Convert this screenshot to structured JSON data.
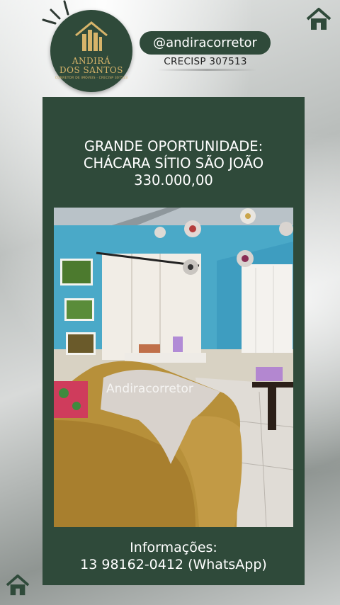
{
  "brand": {
    "name_line1": "ANDIRÁ",
    "name_line2": "DOS SANTOS",
    "tagline": "CORRETOR DE IMÓVEIS · CRECISP 307513"
  },
  "header": {
    "handle": "@andiracorretor",
    "creci": "CRECISP 307513"
  },
  "card": {
    "headline_line1": "GRANDE OPORTUNIDADE:",
    "headline_line2": "CHÁCARA SÍTIO SÃO JOÃO",
    "price": "330.000,00",
    "watermark": "Andiracorretor",
    "info_label": "Informações:",
    "info_phone": "13 98162-0412 (WhatsApp)"
  },
  "colors": {
    "brand_green": "#2f4a3a",
    "gold": "#d7b46a",
    "wall_blue": "#4aa9c8"
  },
  "icons": [
    "home-icon",
    "home-icon"
  ]
}
